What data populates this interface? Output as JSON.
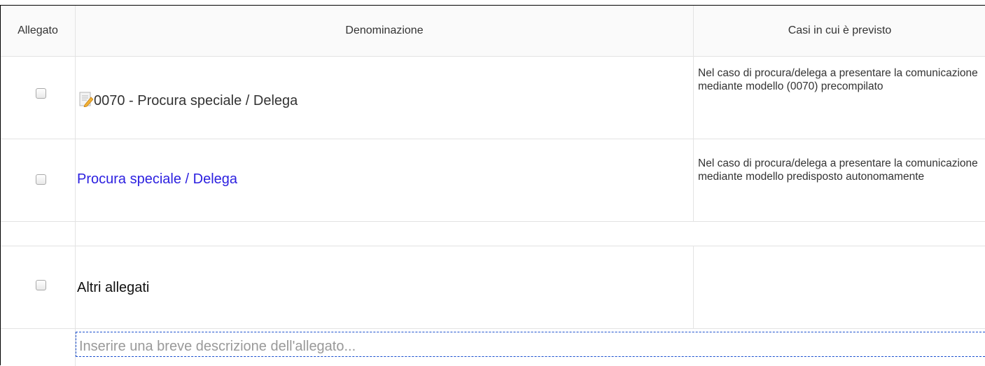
{
  "table": {
    "headers": {
      "allegato": "Allegato",
      "denominazione": "Denominazione",
      "casi": "Casi in cui è previsto"
    },
    "rows": [
      {
        "name": "0070 - Procura speciale / Delega",
        "cases": "Nel caso di procura/delega a presentare la comunicazione mediante modello (0070) precompilato",
        "icon": "document-edit-icon",
        "checked": false
      },
      {
        "name": "Procura speciale / Delega",
        "cases": "Nel caso di procura/delega a presentare la comunicazione mediante modello predisposto autonomamente",
        "checked": false
      },
      {
        "name": "Altri allegati",
        "cases": "",
        "checked": false
      }
    ],
    "description_placeholder": "Inserire una breve descrizione dell'allegato..."
  },
  "colors": {
    "link": "#2b1fe0",
    "border": "#e3e3e3",
    "input_border": "#1a4fcf"
  }
}
